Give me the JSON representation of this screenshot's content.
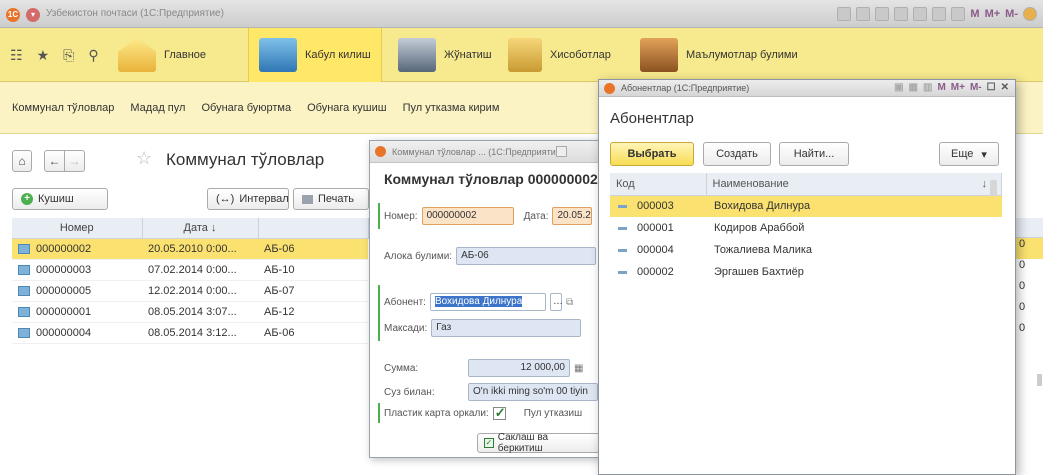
{
  "app": {
    "title": "Узбекистон почтаси (1С:Предприятие)",
    "title_tools": [
      "M",
      "M+",
      "M-"
    ]
  },
  "sections": [
    {
      "label": "Главное",
      "icon": "home-icon"
    },
    {
      "label": "Кабул килиш",
      "icon": "building-icon"
    },
    {
      "label": "Жўнатиш",
      "icon": "cash-register-icon"
    },
    {
      "label": "Хисоботлар",
      "icon": "reports-icon"
    },
    {
      "label": "Маълумотлар булими",
      "icon": "boxes-icon"
    }
  ],
  "functions": [
    "Коммунал тўловлар",
    "Мадад пул",
    "Обунага буюртма",
    "Обунага кушиш",
    "Пул утказма кирим"
  ],
  "list_form": {
    "title": "Коммунал тўловлар",
    "add_label": "Кушиш",
    "interval_label": "Интервал",
    "print_label": "Печать",
    "columns": [
      "Номер",
      "Дата"
    ],
    "rows": [
      {
        "number": "000000002",
        "date": "20.05.2010 0:00...",
        "dept": "АБ-06",
        "tail": "0"
      },
      {
        "number": "000000003",
        "date": "07.02.2014 0:00...",
        "dept": "АБ-10",
        "tail": "0"
      },
      {
        "number": "000000005",
        "date": "12.02.2014 0:00...",
        "dept": "АБ-07",
        "tail": "0"
      },
      {
        "number": "000000001",
        "date": "08.05.2014 3:07...",
        "dept": "АБ-12",
        "tail": "0"
      },
      {
        "number": "000000004",
        "date": "08.05.2014 3:12...",
        "dept": "АБ-06",
        "tail": "0"
      }
    ]
  },
  "doc_form": {
    "window_title": "Коммунал тўловлар ... (1С:Предприятие)",
    "heading": "Коммунал тўловлар 000000002",
    "number_label": "Номер:",
    "number_value": "000000002",
    "date_label": "Дата:",
    "date_value": "20.05.2",
    "dept_label": "Алока булими:",
    "dept_value": "АБ-06",
    "subscriber_label": "Абонент:",
    "subscriber_value": "Вохидова Дилнура",
    "purpose_label": "Максади:",
    "purpose_value": "Газ",
    "sum_label": "Сумма:",
    "sum_value": "12 000,00",
    "words_label": "Суз билан:",
    "words_value": "O'n ikki ming so'm 00 tiyin",
    "card_label": "Пластик карта оркали:",
    "transfer_label": "Пул утказиш",
    "save_label": "Саклаш ва беркитиш"
  },
  "choice_form": {
    "window_title": "Абонентлар (1С:Предприятие)",
    "title_tools": [
      "M",
      "M+",
      "M-"
    ],
    "heading": "Абонентлар",
    "select_label": "Выбрать",
    "create_label": "Создать",
    "find_label": "Найти...",
    "more_label": "Еще",
    "columns": {
      "code": "Код",
      "name": "Наименование"
    },
    "rows": [
      {
        "code": "000003",
        "name": "Вохидова Дилнура"
      },
      {
        "code": "000001",
        "name": "Кодиров Араббой"
      },
      {
        "code": "000004",
        "name": "Тожалиева Малика"
      },
      {
        "code": "000002",
        "name": "Эргашев Бахтиёр"
      }
    ]
  },
  "colors": {
    "section_bar": "#f6e98e",
    "selection": "#fbe270",
    "panel": "#fbf3c4"
  }
}
